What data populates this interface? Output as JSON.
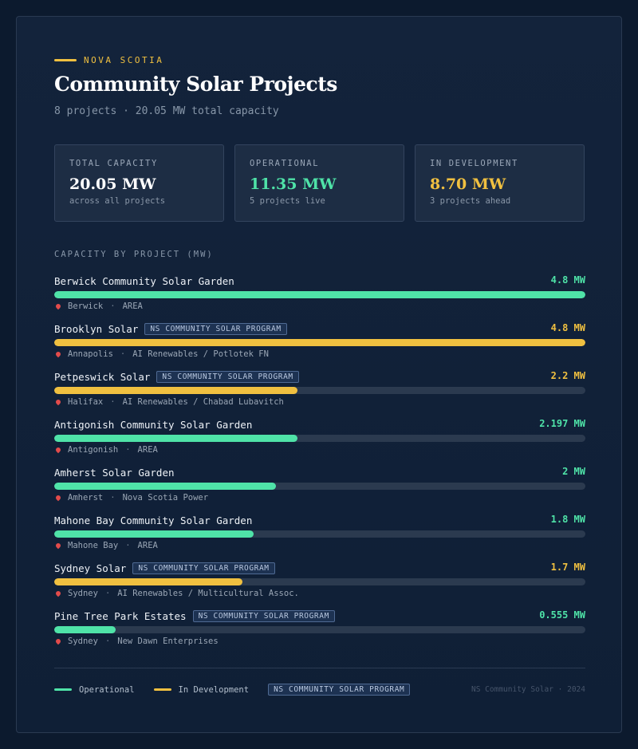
{
  "header": {
    "eyebrow": "NOVA SCOTIA",
    "title": "Community Solar Projects",
    "subtitle": "8 projects · 20.05 MW total capacity"
  },
  "stats": [
    {
      "label": "TOTAL CAPACITY",
      "value": "20.05 MW",
      "sub": "across all projects",
      "color": "#ffffff"
    },
    {
      "label": "OPERATIONAL",
      "value": "11.35 MW",
      "sub": "5 projects live",
      "color": "#4fe3a8"
    },
    {
      "label": "IN DEVELOPMENT",
      "value": "8.70 MW",
      "sub": "3 projects ahead",
      "color": "#f0c040"
    }
  ],
  "section_label": "CAPACITY BY PROJECT (MW)",
  "colors": {
    "operational": "#4fe3a8",
    "development": "#f0c040"
  },
  "chart_data": {
    "type": "bar",
    "orientation": "horizontal",
    "xlim": [
      0,
      4.8
    ],
    "projects": [
      {
        "name": "Berwick Community Solar Garden",
        "badge": "",
        "value": 4.8,
        "value_label": "4.8 MW",
        "location": "Berwick",
        "developer": "AREA",
        "status": "operational"
      },
      {
        "name": "Brooklyn Solar",
        "badge": "NS COMMUNITY SOLAR PROGRAM",
        "value": 4.8,
        "value_label": "4.8 MW",
        "location": "Annapolis",
        "developer": "AI Renewables / Potlotek FN",
        "status": "development"
      },
      {
        "name": "Petpeswick Solar",
        "badge": "NS COMMUNITY SOLAR PROGRAM",
        "value": 2.2,
        "value_label": "2.2 MW",
        "location": "Halifax",
        "developer": "AI Renewables / Chabad Lubavitch",
        "status": "development"
      },
      {
        "name": "Antigonish Community Solar Garden",
        "badge": "",
        "value": 2.197,
        "value_label": "2.197 MW",
        "location": "Antigonish",
        "developer": "AREA",
        "status": "operational"
      },
      {
        "name": "Amherst Solar Garden",
        "badge": "",
        "value": 2,
        "value_label": "2 MW",
        "location": "Amherst",
        "developer": "Nova Scotia Power",
        "status": "operational"
      },
      {
        "name": "Mahone Bay Community Solar Garden",
        "badge": "",
        "value": 1.8,
        "value_label": "1.8 MW",
        "location": "Mahone Bay",
        "developer": "AREA",
        "status": "operational"
      },
      {
        "name": "Sydney Solar",
        "badge": "NS COMMUNITY SOLAR PROGRAM",
        "value": 1.7,
        "value_label": "1.7 MW",
        "location": "Sydney",
        "developer": "AI Renewables / Multicultural Assoc.",
        "status": "development"
      },
      {
        "name": "Pine Tree Park Estates",
        "badge": "NS COMMUNITY SOLAR PROGRAM",
        "value": 0.555,
        "value_label": "0.555 MW",
        "location": "Sydney",
        "developer": "New Dawn Enterprises",
        "status": "operational"
      }
    ]
  },
  "legend": {
    "operational": "Operational",
    "development": "In Development",
    "badge": "NS COMMUNITY SOLAR PROGRAM"
  },
  "footer_note": "NS Community Solar · 2024"
}
